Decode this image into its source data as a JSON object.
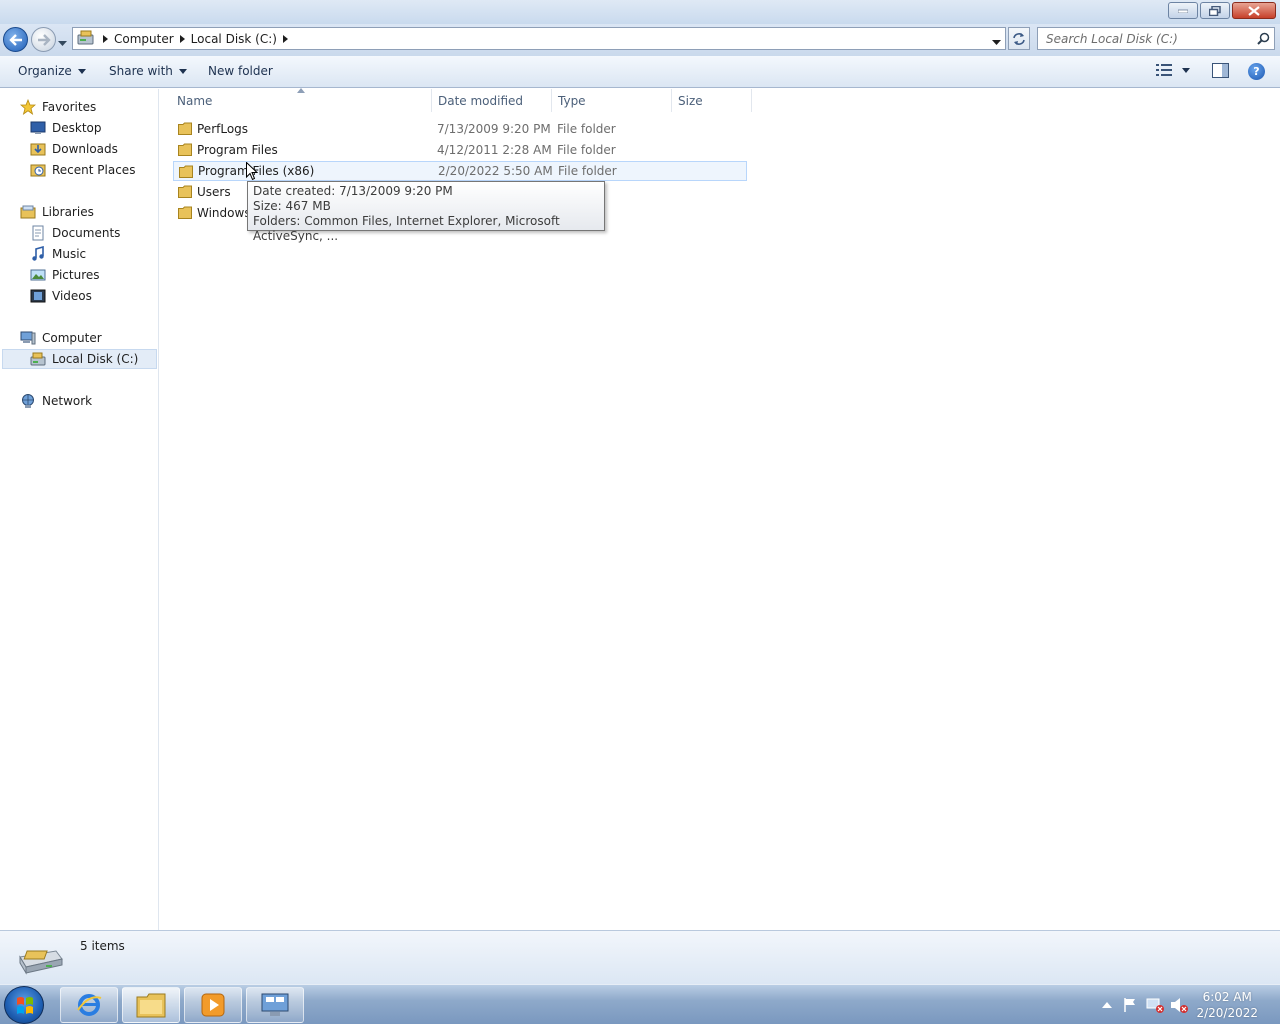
{
  "address": {
    "crumbs": [
      "Computer",
      "Local Disk (C:)"
    ]
  },
  "search": {
    "placeholder": "Search Local Disk (C:)"
  },
  "toolbar": {
    "organize_label": "Organize",
    "share_label": "Share with",
    "new_folder_label": "New folder"
  },
  "nav": {
    "favorites": "Favorites",
    "favorites_items": [
      "Desktop",
      "Downloads",
      "Recent Places"
    ],
    "libraries": "Libraries",
    "libraries_items": [
      "Documents",
      "Music",
      "Pictures",
      "Videos"
    ],
    "computer": "Computer",
    "computer_items": [
      "Local Disk (C:)"
    ],
    "network": "Network"
  },
  "columns": [
    "Name",
    "Date modified",
    "Type",
    "Size"
  ],
  "files": [
    {
      "name": "PerfLogs",
      "date": "7/13/2009 9:20 PM",
      "type": "File folder"
    },
    {
      "name": "Program Files",
      "date": "4/12/2011 2:28 AM",
      "type": "File folder"
    },
    {
      "name": "Program Files (x86)",
      "date": "2/20/2022 5:50 AM",
      "type": "File folder"
    },
    {
      "name": "Users",
      "date": "",
      "type": ""
    },
    {
      "name": "Windows",
      "date": "",
      "type": ""
    }
  ],
  "tooltip": {
    "line1": "Date created: 7/13/2009 9:20 PM",
    "line2": "Size: 467 MB",
    "line3": "Folders: Common Files, Internet Explorer, Microsoft ActiveSync, ..."
  },
  "details": {
    "count": "5 items"
  },
  "taskbar": {
    "time": "6:02 AM",
    "date": "2/20/2022"
  },
  "colors": {
    "accent": "#1f5fb8",
    "selection": "#e3ecf7",
    "folder": "#e8c25a"
  }
}
